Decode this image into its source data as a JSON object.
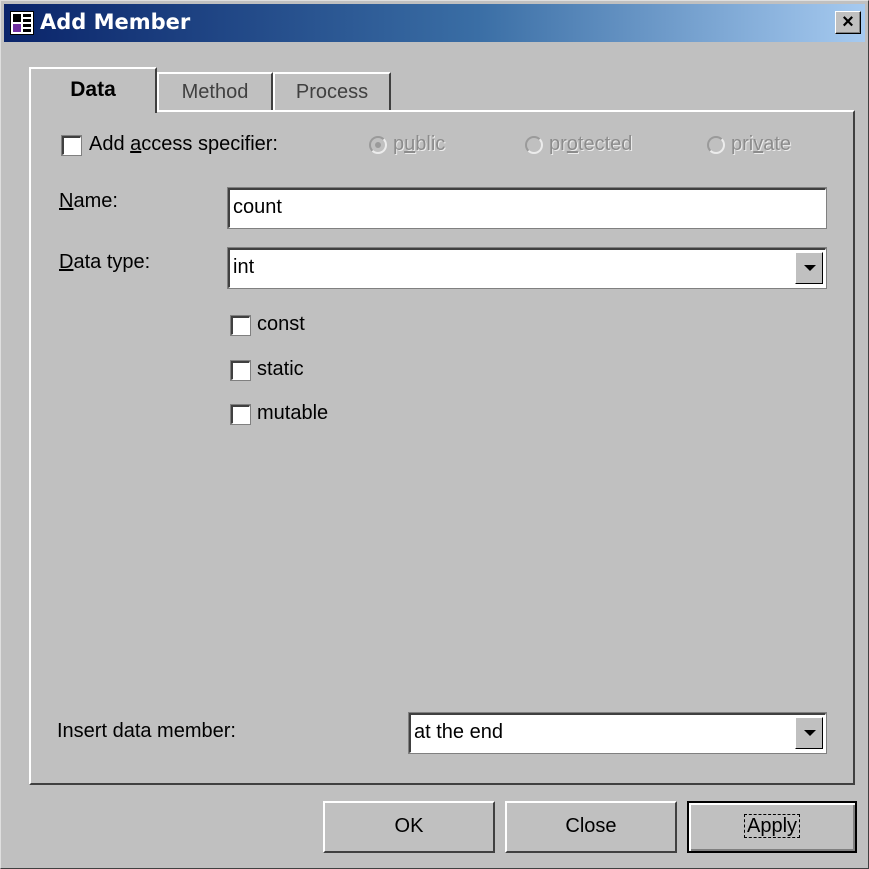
{
  "window": {
    "title": "Add Member",
    "close_label": "×"
  },
  "tabs": [
    {
      "label": "Data",
      "active": true
    },
    {
      "label": "Method",
      "active": false
    },
    {
      "label": "Process",
      "active": false
    }
  ],
  "access": {
    "checkbox_label_pre": "Add ",
    "checkbox_label_mn": "a",
    "checkbox_label_post": "ccess specifier:",
    "checked": false,
    "options": [
      {
        "pre": "p",
        "mn": "u",
        "post": "blic",
        "selected": true
      },
      {
        "pre": "pr",
        "mn": "o",
        "post": "tected",
        "selected": false
      },
      {
        "pre": "pri",
        "mn": "v",
        "post": "ate",
        "selected": false
      }
    ]
  },
  "name": {
    "label_mn": "N",
    "label_rest": "ame:",
    "value": "count"
  },
  "data_type": {
    "label_mn": "D",
    "label_rest": "ata type:",
    "value": "int"
  },
  "modifiers": [
    {
      "label": "const",
      "checked": false
    },
    {
      "label": "static",
      "checked": false
    },
    {
      "label": "mutable",
      "checked": false
    }
  ],
  "insert": {
    "label": "Insert data member:",
    "value": "at the end"
  },
  "buttons": {
    "ok": "OK",
    "close": "Close",
    "apply": "Apply"
  },
  "colors": {
    "title_start": "#0a246a",
    "title_end": "#a6caf0",
    "face": "#c0c0c0"
  }
}
